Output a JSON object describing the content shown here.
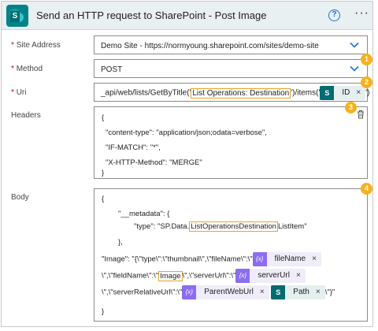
{
  "header": {
    "title": "Send an HTTP request to SharePoint - Post Image",
    "help_glyph": "?",
    "more_glyph": "···",
    "logo_letter": "S"
  },
  "fields": {
    "site_address": {
      "label": "Site Address",
      "required_mark": "*",
      "value": "Demo Site - https://normyoung.sharepoint.com/sites/demo-site"
    },
    "method": {
      "label": "Method",
      "required_mark": "*",
      "value": "POST"
    },
    "uri": {
      "label": "Uri",
      "required_mark": "*",
      "prefix": "_api/web/lists/GetByTitle('",
      "highlight": "List Operations: Destination",
      "middle": "')/items('",
      "token": "ID",
      "suffix": "')"
    },
    "headers": {
      "label": "Headers",
      "lines": [
        "{",
        "\"content-type\": \"application/json;odata=verbose\",",
        "\"IF-MATCH\": \"*\",",
        "\"X-HTTP-Method\": \"MERGE\"",
        "}"
      ]
    },
    "body": {
      "label": "Body",
      "line1": "{",
      "line2": "\"__metadata\": {",
      "line3_prefix": "\"type\": \"SP.Data.",
      "line3_highlight": "ListOperationsDestination",
      "line3_suffix": "ListItem\"",
      "line4": "},",
      "line5_prefix": "\"Image\": \"{\\\"type\\\":\\\"thumbnail\\\",\\\"fileName\\\":\\\"",
      "token_filename": "fileName",
      "line6_prefix": "\\\",\\\"fieldName\\\":\\\"",
      "line6_highlight": "Image",
      "line6_mid": "\\\",\\\"serverUrl\\\":\\\"",
      "token_serverurl": "serverUrl",
      "line7_prefix": "\\\",\\\"serverRelativeUrl\\\":\\\"",
      "token_parentweburl": "ParentWebUrl",
      "token_path": "Path",
      "line7_suffix": "\\\"}\"",
      "line8": "}"
    }
  },
  "token_glyphs": {
    "expression": "{x}",
    "sharepoint": "S",
    "remove": "×"
  },
  "badges": [
    "1",
    "2",
    "3",
    "4"
  ],
  "colors": {
    "accent": "#1f6ed4",
    "badge": "#f5b21d",
    "highlight": "#e5a528",
    "expression_token": "#8c6cf0",
    "sharepoint_token": "#036c70"
  }
}
